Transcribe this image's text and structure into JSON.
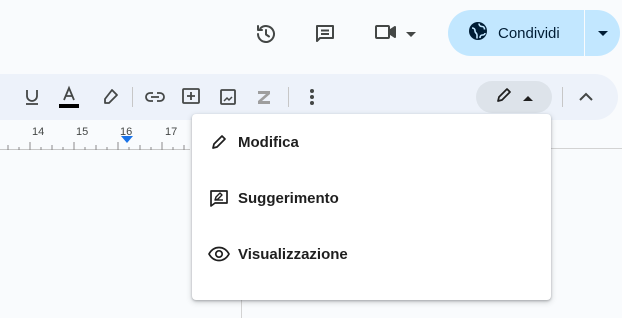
{
  "header": {
    "history_icon": "history-icon",
    "comments_icon": "comment-icon",
    "meet_icon": "video-camera-icon",
    "share": {
      "label": "Condividi",
      "icon": "globe-icon",
      "color": "#c2e7ff"
    }
  },
  "toolbar": {
    "items": [
      "underline-icon",
      "text-color-icon",
      "highlighter-icon",
      "link-icon",
      "add-comment-icon",
      "insert-image-icon",
      "clear-formatting-icon",
      "more-options-icon"
    ],
    "mode_icon": "pencil-icon",
    "collapse_icon": "chevron-up-icon"
  },
  "ruler": {
    "numbers": [
      "14",
      "15",
      "16",
      "17"
    ]
  },
  "menu": {
    "items": [
      {
        "label": "Modifica",
        "icon": "pencil-icon"
      },
      {
        "label": "Suggerimento",
        "icon": "suggest-icon"
      },
      {
        "label": "Visualizzazione",
        "icon": "eye-icon"
      }
    ]
  }
}
